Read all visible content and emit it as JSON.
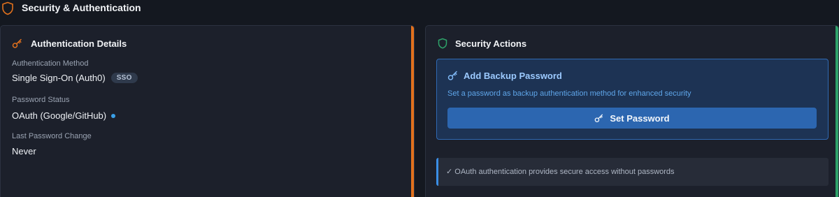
{
  "header": {
    "title": "Security & Authentication",
    "icon": "shield-icon",
    "icon_color": "#e2711d"
  },
  "auth_details": {
    "title": "Authentication Details",
    "icon": "key-icon",
    "accent_color": "#e2711d",
    "method_label": "Authentication Method",
    "method_value": "Single Sign-On (Auth0)",
    "method_badge": "SSO",
    "password_status_label": "Password Status",
    "password_status_value": "OAuth (Google/GitHub)",
    "status_dot_color": "#3aa0e8",
    "last_change_label": "Last Password Change",
    "last_change_value": "Never"
  },
  "security_actions": {
    "title": "Security Actions",
    "icon": "shield-icon",
    "accent_color": "#2ea36a",
    "backup": {
      "title": "Add Backup Password",
      "icon": "key-icon",
      "description": "Set a password as backup authentication method for enhanced security",
      "button_label": "Set Password"
    },
    "info_text": "✓ OAuth authentication provides secure access without passwords"
  }
}
